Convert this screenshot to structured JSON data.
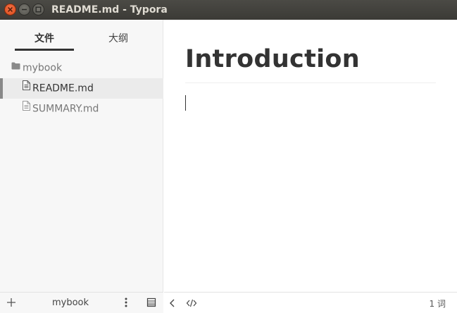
{
  "window": {
    "title": "README.md - Typora",
    "close_icon": "close-icon",
    "minimize_icon": "minimize-icon",
    "maximize_icon": "maximize-icon"
  },
  "sidebar": {
    "tabs": [
      {
        "label": "文件",
        "active": true
      },
      {
        "label": "大纲",
        "active": false
      }
    ],
    "tree": {
      "folder": {
        "label": "mybook",
        "icon": "folder-icon"
      },
      "files": [
        {
          "label": "README.md",
          "icon": "document-icon",
          "active": true
        },
        {
          "label": "SUMMARY.md",
          "icon": "document-icon",
          "active": false
        }
      ]
    },
    "footer": {
      "add_icon": "plus-icon",
      "folder_name": "mybook",
      "more_icon": "vertical-dots-icon",
      "view_icon": "list-view-icon"
    }
  },
  "editor": {
    "heading": "Introduction",
    "footer": {
      "back_icon": "chevron-left-icon",
      "source_icon": "code-icon",
      "word_count": "1 词"
    }
  },
  "colors": {
    "titlebar": "#3e3d39",
    "close_button": "#e5572a",
    "sidebar_bg": "#f7f7f7",
    "active_item_bg": "#ebebeb",
    "text_dark": "#333333"
  }
}
